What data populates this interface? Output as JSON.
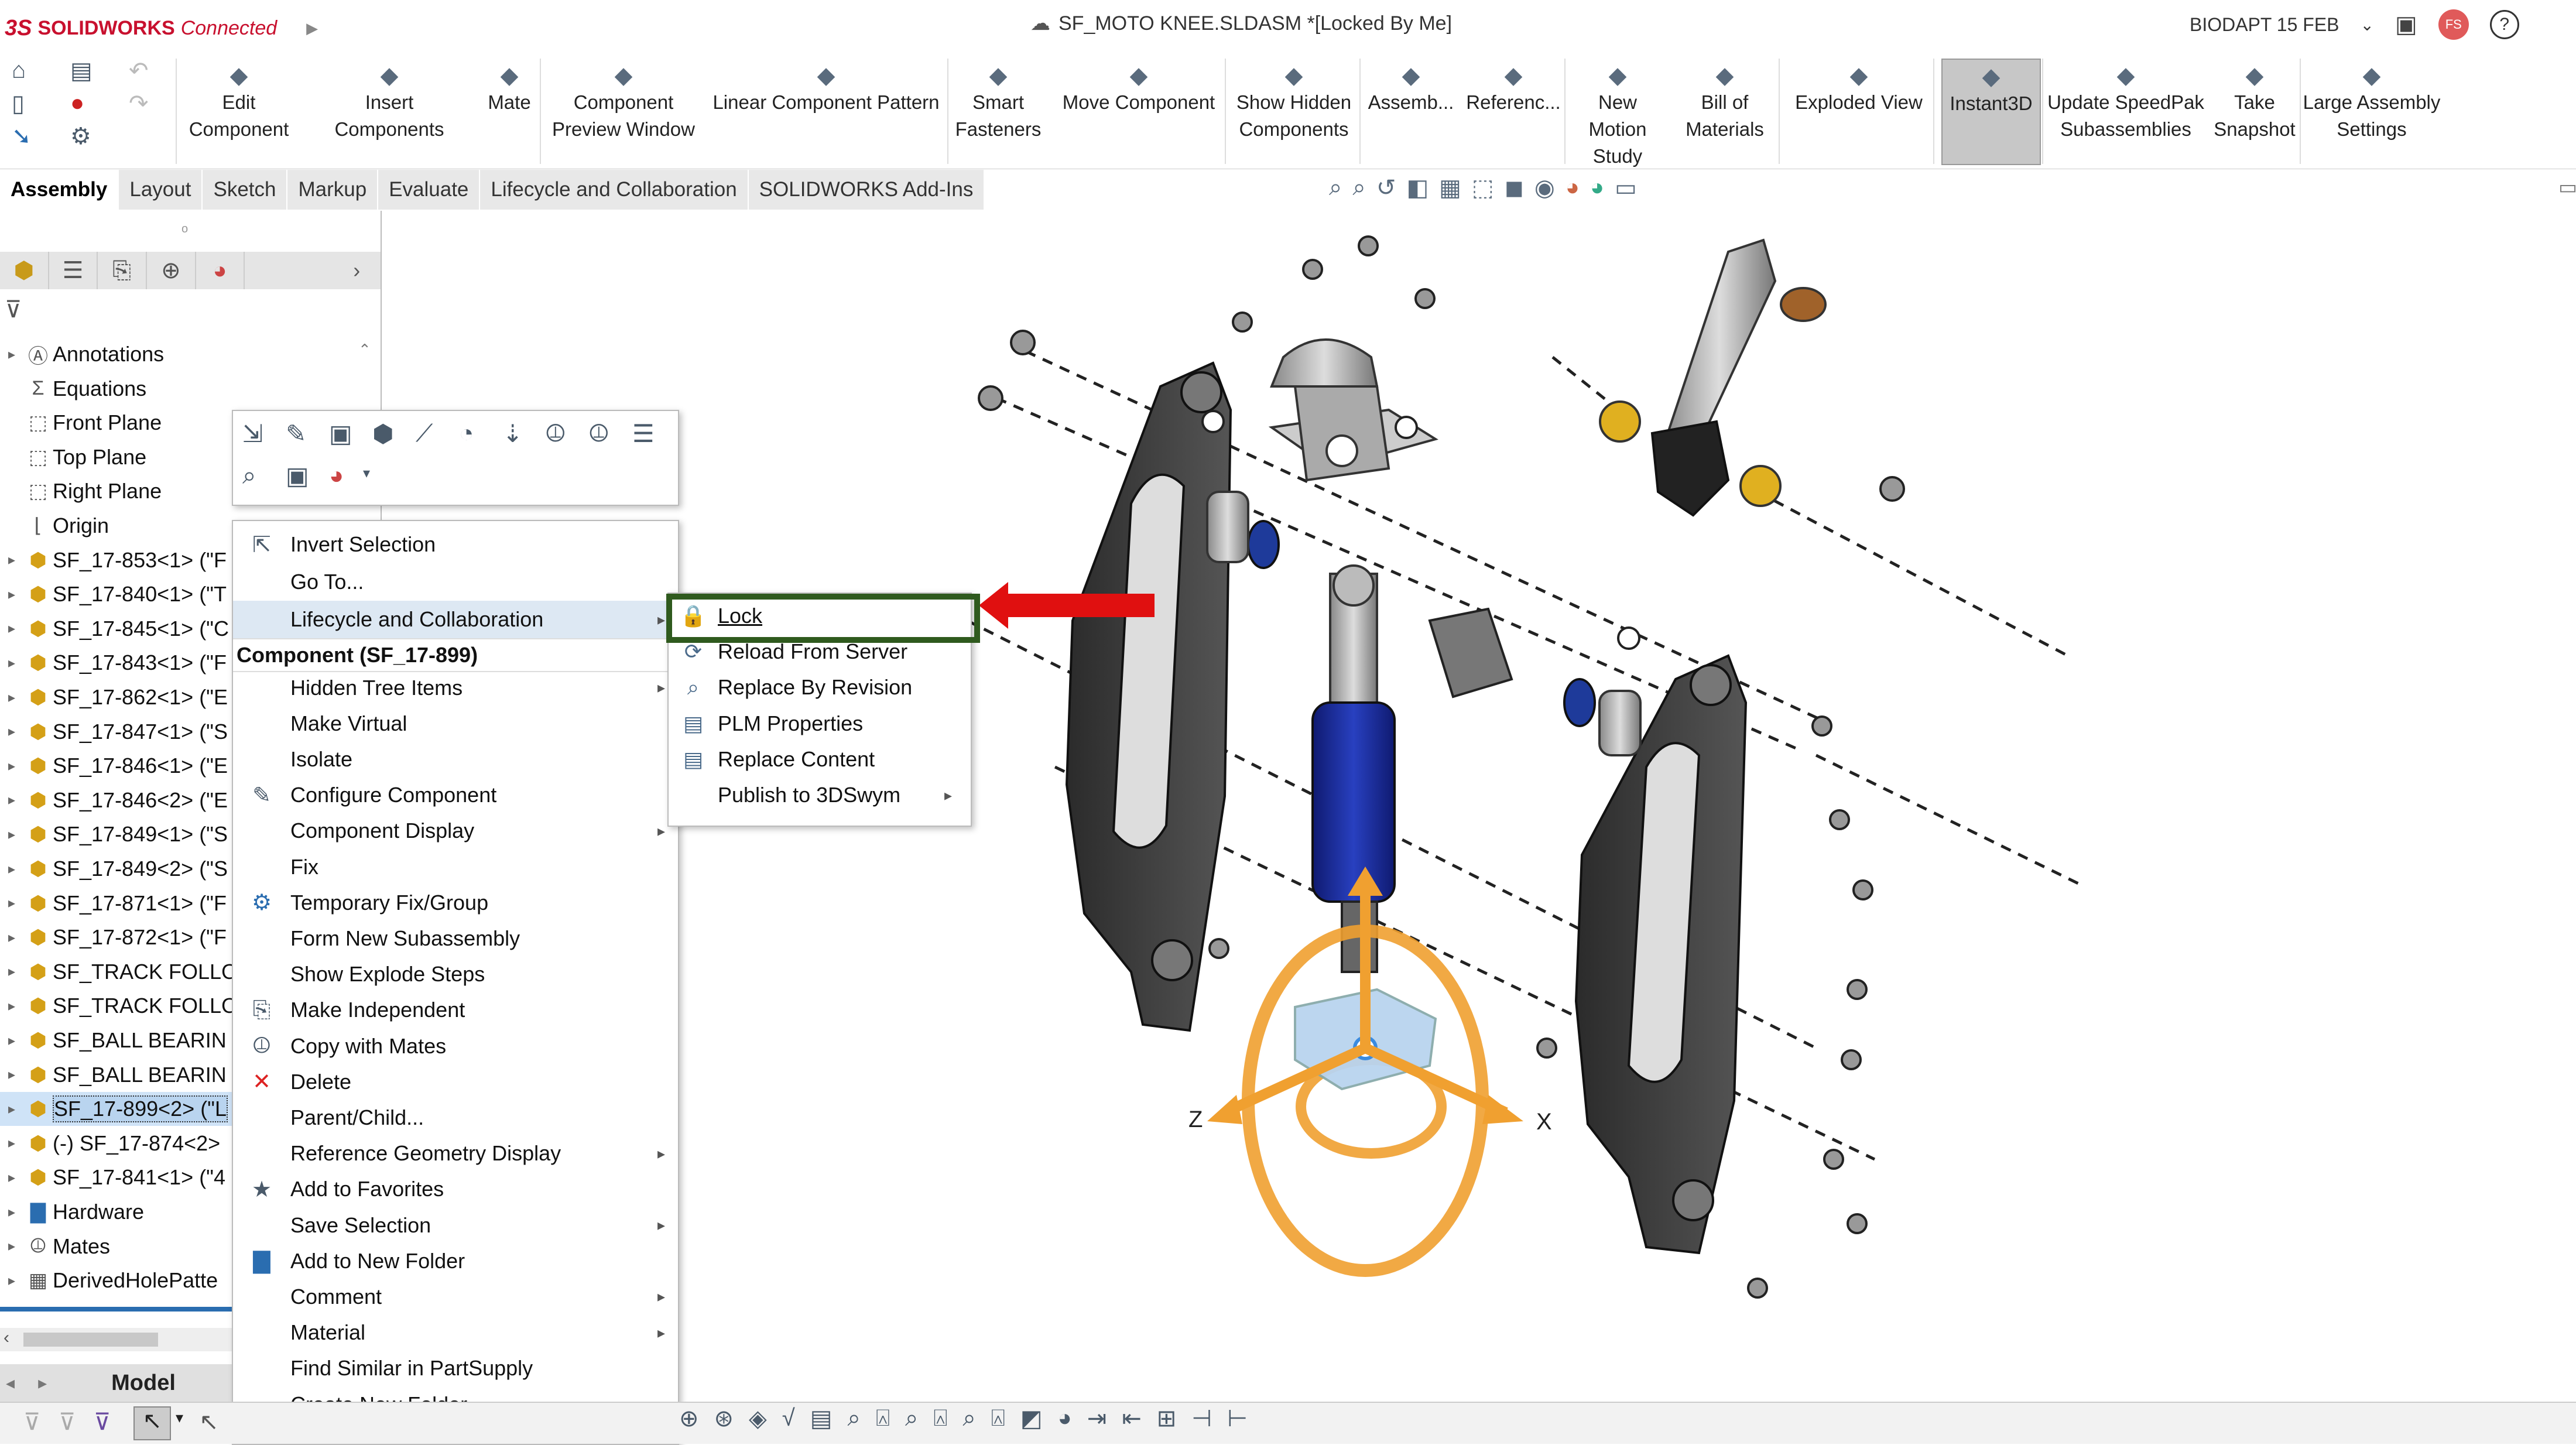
{
  "titlebar": {
    "brand_ds": "3S",
    "brand_name": "SOLIDWORKS",
    "brand_suffix": "Connected",
    "doc_title": "SF_MOTO KNEE.SLDASM *[Locked By Me]",
    "user_label": "BIODAPT 15 FEB",
    "avatar_initials": "FS",
    "help": "?"
  },
  "commands": [
    {
      "label": "Edit\nComponent",
      "icon": "edit-component-icon"
    },
    {
      "label": "Insert Components",
      "icon": "insert-components-icon"
    },
    {
      "label": "Mate",
      "icon": "mate-icon"
    },
    {
      "label": "Component\nPreview Window",
      "icon": "preview-window-icon"
    },
    {
      "label": "Linear Component Pattern",
      "icon": "pattern-icon"
    },
    {
      "label": "Smart\nFasteners",
      "icon": "fastener-icon"
    },
    {
      "label": "Move Component",
      "icon": "move-component-icon"
    },
    {
      "label": "Show Hidden\nComponents",
      "icon": "show-hidden-icon"
    },
    {
      "label": "Assemb...",
      "icon": "assembly-features-icon"
    },
    {
      "label": "Referenc...",
      "icon": "reference-geometry-icon"
    },
    {
      "label": "New Motion\nStudy",
      "icon": "motion-study-icon"
    },
    {
      "label": "Bill of\nMaterials",
      "icon": "bom-icon"
    },
    {
      "label": "Exploded View",
      "icon": "exploded-view-icon"
    },
    {
      "label": "Instant3D",
      "icon": "instant3d-icon"
    },
    {
      "label": "Update SpeedPak\nSubassemblies",
      "icon": "speedpak-icon"
    },
    {
      "label": "Take\nSnapshot",
      "icon": "snapshot-icon"
    },
    {
      "label": "Large Assembly\nSettings",
      "icon": "large-assembly-icon"
    }
  ],
  "tabs": [
    "Assembly",
    "Layout",
    "Sketch",
    "Markup",
    "Evaluate",
    "Lifecycle and Collaboration",
    "SOLIDWORKS Add-Ins"
  ],
  "tree": [
    {
      "label": "Annotations",
      "icon": "annotations-icon",
      "arrow": "▸"
    },
    {
      "label": "Equations",
      "icon": "equations-icon",
      "arrow": ""
    },
    {
      "label": "Front Plane",
      "icon": "plane-icon",
      "arrow": ""
    },
    {
      "label": "Top Plane",
      "icon": "plane-icon",
      "arrow": ""
    },
    {
      "label": "Right Plane",
      "icon": "plane-icon",
      "arrow": ""
    },
    {
      "label": "Origin",
      "icon": "origin-icon",
      "arrow": ""
    },
    {
      "label": "SF_17-853<1> (\"F",
      "icon": "part-icon",
      "arrow": "▸"
    },
    {
      "label": "SF_17-840<1> (\"T",
      "icon": "part-icon",
      "arrow": "▸"
    },
    {
      "label": "SF_17-845<1> (\"C",
      "icon": "part-icon",
      "arrow": "▸"
    },
    {
      "label": "SF_17-843<1> (\"F",
      "icon": "part-icon",
      "arrow": "▸"
    },
    {
      "label": "SF_17-862<1> (\"E",
      "icon": "part-icon",
      "arrow": "▸"
    },
    {
      "label": "SF_17-847<1> (\"S",
      "icon": "part-icon",
      "arrow": "▸"
    },
    {
      "label": "SF_17-846<1> (\"E",
      "icon": "part-icon",
      "arrow": "▸"
    },
    {
      "label": "SF_17-846<2> (\"E",
      "icon": "part-icon",
      "arrow": "▸"
    },
    {
      "label": "SF_17-849<1> (\"S",
      "icon": "part-icon",
      "arrow": "▸"
    },
    {
      "label": "SF_17-849<2> (\"S",
      "icon": "part-icon",
      "arrow": "▸"
    },
    {
      "label": "SF_17-871<1> (\"F",
      "icon": "part-icon",
      "arrow": "▸"
    },
    {
      "label": "SF_17-872<1> (\"F",
      "icon": "part-icon",
      "arrow": "▸"
    },
    {
      "label": "SF_TRACK FOLLO",
      "icon": "part-icon",
      "arrow": "▸"
    },
    {
      "label": "SF_TRACK FOLLO",
      "icon": "part-icon",
      "arrow": "▸"
    },
    {
      "label": "SF_BALL BEARIN",
      "icon": "part-icon",
      "arrow": "▸"
    },
    {
      "label": "SF_BALL BEARIN",
      "icon": "part-icon",
      "arrow": "▸"
    },
    {
      "label": "SF_17-899<2> (\"L",
      "icon": "part-icon",
      "arrow": "▸",
      "selected": true
    },
    {
      "label": "(-) SF_17-874<2>",
      "icon": "part-icon",
      "arrow": "▸"
    },
    {
      "label": "SF_17-841<1> (\"4",
      "icon": "part-icon",
      "arrow": "▸"
    },
    {
      "label": "Hardware",
      "icon": "folder-icon",
      "arrow": "▸"
    },
    {
      "label": "Mates",
      "icon": "mates-icon",
      "arrow": "▸"
    },
    {
      "label": "DerivedHolePatte",
      "icon": "pattern-icon",
      "arrow": "▸"
    }
  ],
  "model_tab": "Model",
  "context_menu": [
    {
      "label": "Invert Selection",
      "icon": "invert-selection-icon",
      "sub": false
    },
    {
      "label": "Go To...",
      "icon": "",
      "sub": false
    },
    {
      "label": "Lifecycle and Collaboration",
      "icon": "",
      "sub": true,
      "highlight": true
    },
    {
      "label": "Component (SF_17-899)",
      "header": true
    },
    {
      "label": "Hidden Tree Items",
      "icon": "",
      "sub": true
    },
    {
      "label": "Make Virtual",
      "icon": "",
      "sub": false
    },
    {
      "label": "Isolate",
      "icon": "",
      "sub": false
    },
    {
      "label": "Configure Component",
      "icon": "configure-icon",
      "sub": false
    },
    {
      "label": "Component Display",
      "icon": "",
      "sub": true
    },
    {
      "label": "Fix",
      "icon": "",
      "sub": false
    },
    {
      "label": "Temporary Fix/Group",
      "icon": "temp-fix-icon",
      "sub": false
    },
    {
      "label": "Form New Subassembly",
      "icon": "",
      "sub": false
    },
    {
      "label": "Show Explode Steps",
      "icon": "",
      "sub": false
    },
    {
      "label": "Make Independent",
      "icon": "make-independent-icon",
      "sub": false
    },
    {
      "label": "Copy with Mates",
      "icon": "copy-mates-icon",
      "sub": false
    },
    {
      "label": "Delete",
      "icon": "delete-icon",
      "sub": false
    },
    {
      "label": "Parent/Child...",
      "icon": "",
      "sub": false
    },
    {
      "label": "Reference Geometry Display",
      "icon": "",
      "sub": true
    },
    {
      "label": "Add to Favorites",
      "icon": "favorites-icon",
      "sub": false
    },
    {
      "label": "Save Selection",
      "icon": "",
      "sub": true
    },
    {
      "label": "Add to New Folder",
      "icon": "folder-icon",
      "sub": false
    },
    {
      "label": "Comment",
      "icon": "",
      "sub": true
    },
    {
      "label": "Material",
      "icon": "",
      "sub": true
    },
    {
      "label": "Find Similar in PartSupply",
      "icon": "",
      "sub": false
    },
    {
      "label": "Create New Folder",
      "icon": "",
      "sub": false
    }
  ],
  "submenu": [
    {
      "label": "Lock",
      "icon": "lock-icon",
      "sub": false
    },
    {
      "label": "Reload From Server",
      "icon": "reload-icon",
      "sub": false
    },
    {
      "label": "Replace By Revision",
      "icon": "replace-revision-icon",
      "sub": false
    },
    {
      "label": "PLM Properties",
      "icon": "plm-properties-icon",
      "sub": false
    },
    {
      "label": "Replace Content",
      "icon": "replace-content-icon",
      "sub": false
    },
    {
      "label": "Publish to 3DSwym",
      "icon": "",
      "sub": true
    }
  ],
  "triad": {
    "x_label": "X",
    "z_label": "Z"
  },
  "colors": {
    "brand": "#c8102e",
    "highlight_box": "#2f5a1e",
    "arrow": "#e01010",
    "triad": "#f0a030",
    "shock_blue": "#1a2a8c"
  }
}
